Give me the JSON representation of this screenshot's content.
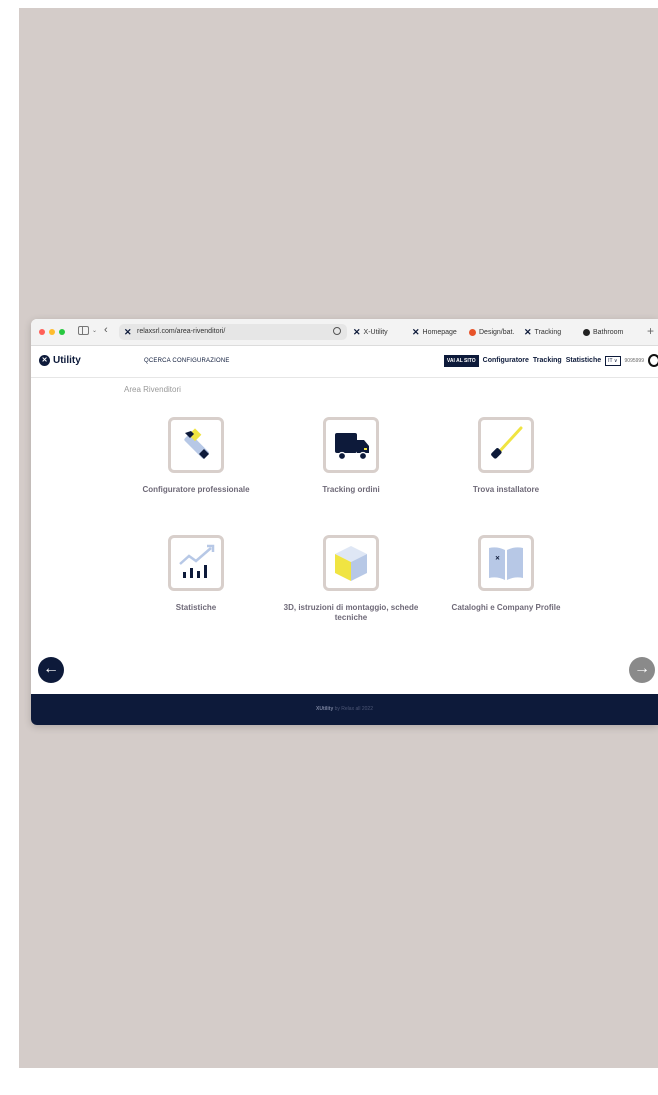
{
  "browser": {
    "url": "relaxsrl.com/area-rivenditori/",
    "tabs": [
      {
        "label": "X-Utility",
        "icon": "x-logo-icon"
      },
      {
        "label": "Homepage",
        "icon": "x-logo-icon"
      },
      {
        "label": "Design/bat.",
        "icon": "design-icon"
      },
      {
        "label": "Tracking",
        "icon": "x-logo-icon"
      },
      {
        "label": "Bathroom",
        "icon": "bathroom-icon"
      }
    ],
    "new_tab": "+"
  },
  "header": {
    "logo_text": "Utility",
    "search_label": "CERCA CONFIGURAZIONE",
    "search_icon": "Q",
    "vai_al_sito": "VAI AL SITO",
    "nav": [
      "Configuratore",
      "Tracking",
      "Statistiche"
    ],
    "lang": "IT ∨",
    "user_code": "9095999"
  },
  "breadcrumb": "Area Rivenditori",
  "cards": [
    {
      "label": "Configuratore professionale",
      "icon": "tools-icon"
    },
    {
      "label": "Tracking ordini",
      "icon": "truck-icon"
    },
    {
      "label": "Trova installatore",
      "icon": "screwdriver-icon"
    },
    {
      "label": "Statistiche",
      "icon": "chart-icon"
    },
    {
      "label": "3D, istruzioni di montaggio, schede tecniche",
      "icon": "cube-icon"
    },
    {
      "label": "Cataloghi e Company Profile",
      "icon": "catalog-icon"
    }
  ],
  "footer": {
    "brand": "XUtility",
    "text": "by Relax all 2022"
  },
  "colors": {
    "navy": "#0d1a3a",
    "accent_yellow": "#f0e442",
    "tile_border": "#d8cfcb",
    "light_blue": "#b7c8e6"
  }
}
